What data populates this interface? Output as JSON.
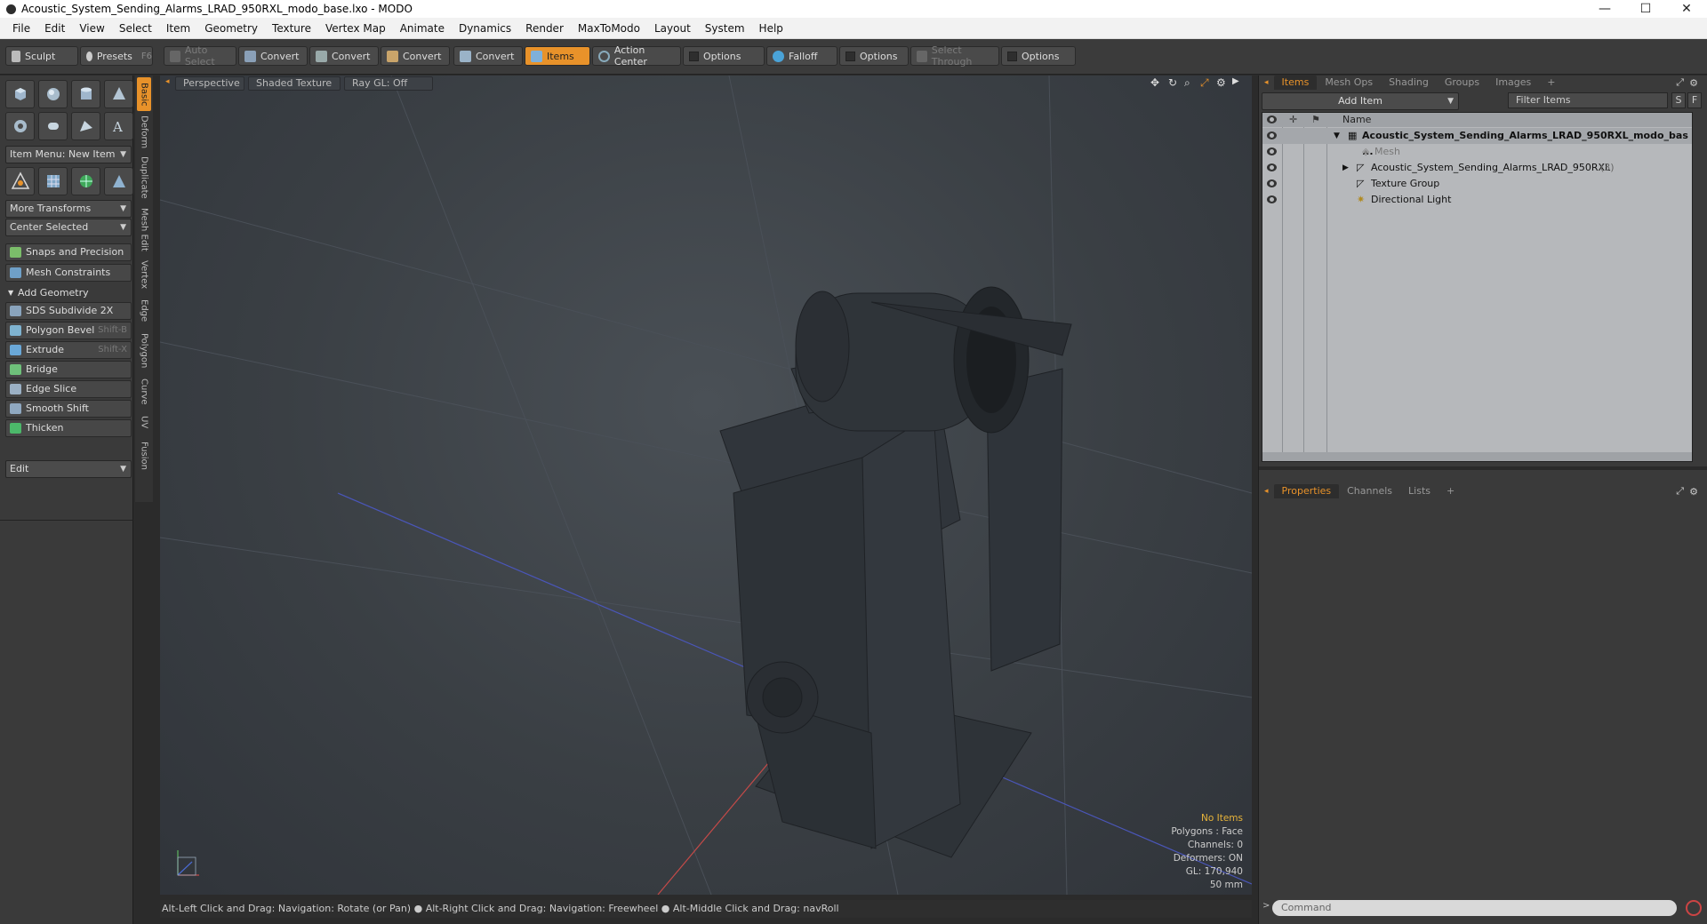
{
  "window": {
    "title": "Acoustic_System_Sending_Alarms_LRAD_950RXL_modo_base.lxo - MODO",
    "minimize": "—",
    "maximize": "☐",
    "close": "✕"
  },
  "menu": [
    "File",
    "Edit",
    "View",
    "Select",
    "Item",
    "Geometry",
    "Texture",
    "Vertex Map",
    "Animate",
    "Dynamics",
    "Render",
    "MaxToModo",
    "Layout",
    "System",
    "Help"
  ],
  "toolbar": {
    "sculpt": "Sculpt",
    "presets": "Presets",
    "presets_key": "F6",
    "auto_select": "Auto Select",
    "convert1": "Convert",
    "convert2": "Convert",
    "convert3": "Convert",
    "convert4": "Convert",
    "items": "Items",
    "action_center": "Action Center",
    "options1": "Options",
    "falloff": "Falloff",
    "options2": "Options",
    "select_through": "Select Through",
    "options3": "Options"
  },
  "left": {
    "item_menu": "Item Menu: New Item",
    "more_transforms": "More Transforms",
    "center_selected": "Center Selected",
    "snaps": "Snaps and Precision",
    "mesh_constraints": "Mesh Constraints",
    "add_geometry": "Add Geometry",
    "tools": [
      {
        "label": "SDS Subdivide 2X",
        "shortcut": ""
      },
      {
        "label": "Polygon Bevel",
        "shortcut": "Shift-B"
      },
      {
        "label": "Extrude",
        "shortcut": "Shift-X"
      },
      {
        "label": "Bridge",
        "shortcut": ""
      },
      {
        "label": "Edge Slice",
        "shortcut": ""
      },
      {
        "label": "Smooth Shift",
        "shortcut": ""
      },
      {
        "label": "Thicken",
        "shortcut": ""
      }
    ],
    "edit": "Edit",
    "vtabs": [
      "Basic",
      "Deform",
      "Duplicate",
      "Mesh Edit",
      "Vertex",
      "Edge",
      "Polygon",
      "Curve",
      "UV",
      "Fusion"
    ]
  },
  "viewport": {
    "perspective": "Perspective",
    "shading": "Shaded Texture",
    "raygl": "Ray GL: Off",
    "hud": {
      "no_items": "No Items",
      "polygons": "Polygons : Face",
      "channels": "Channels: 0",
      "deformers": "Deformers: ON",
      "gl": "GL: 170,940",
      "mm": "50 mm"
    }
  },
  "status": "Alt-Left Click and Drag: Navigation: Rotate (or Pan) ● Alt-Right Click and Drag: Navigation: Freewheel ● Alt-Middle Click and Drag: navRoll",
  "right": {
    "tabs": [
      "Items",
      "Mesh Ops",
      "Shading",
      "Groups",
      "Images",
      "+"
    ],
    "add_item": "Add Item",
    "filter_items": "Filter Items",
    "s_btn": "S",
    "f_btn": "F",
    "name_header": "Name",
    "tree": [
      {
        "label": "Acoustic_System_Sending_Alarms_LRAD_950RXL_modo_bas ...",
        "count": ""
      },
      {
        "label": "Mesh",
        "count": ""
      },
      {
        "label": "Acoustic_System_Sending_Alarms_LRAD_950RXL",
        "count": "(3)"
      },
      {
        "label": "Texture Group",
        "count": ""
      },
      {
        "label": "Directional Light",
        "count": ""
      }
    ],
    "bottom_tabs": [
      "Properties",
      "Channels",
      "Lists",
      "+"
    ],
    "command": "Command"
  },
  "colors": {
    "accent": "#e8922a",
    "panel": "#3a3a3a",
    "viewport": "#3a3f44"
  }
}
